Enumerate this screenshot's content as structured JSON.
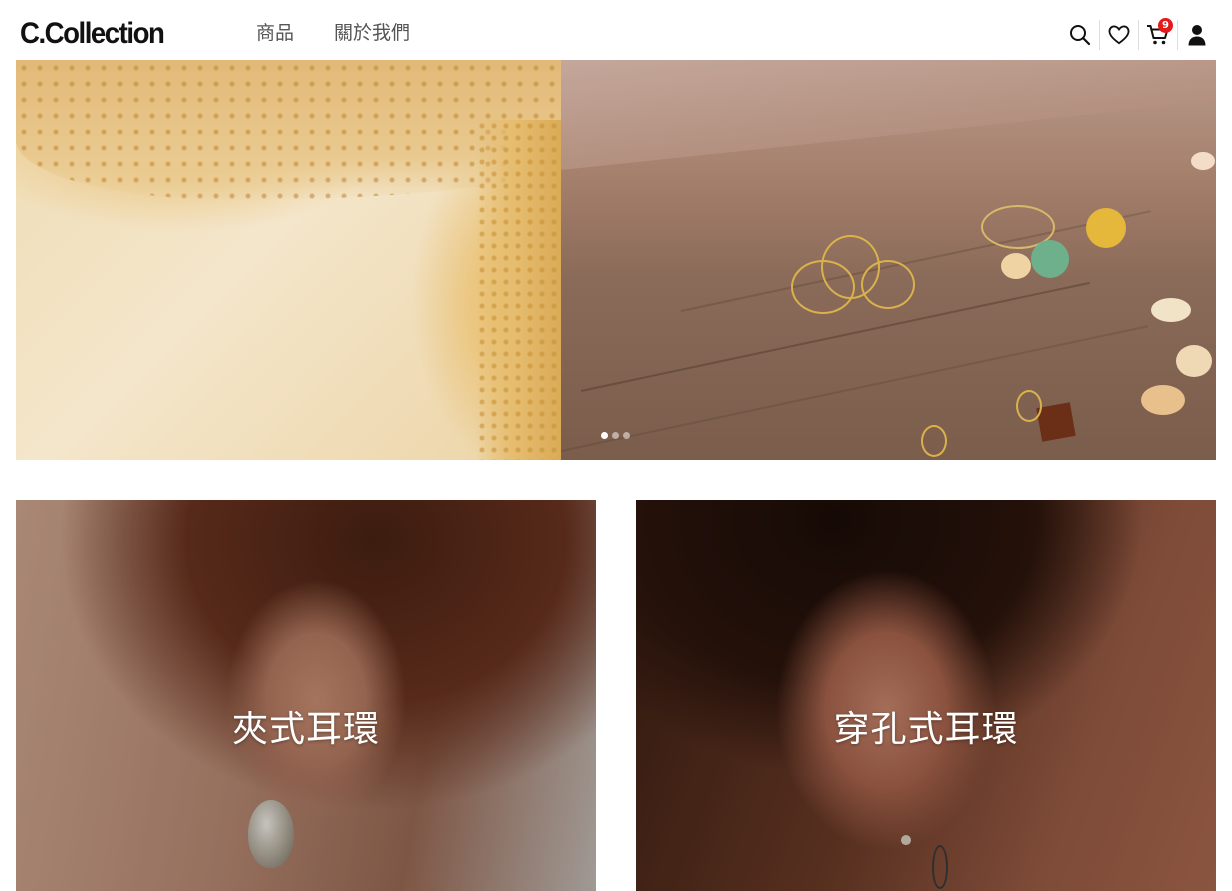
{
  "header": {
    "logo": "C.Collection",
    "nav": [
      {
        "label": "商品"
      },
      {
        "label": "關於我們"
      }
    ],
    "icons": [
      {
        "name": "search-icon"
      },
      {
        "name": "heart-icon"
      },
      {
        "name": "cart-icon",
        "badge": "9"
      },
      {
        "name": "user-icon"
      }
    ]
  },
  "hero": {
    "slides": [
      {
        "name": "lace-slide"
      },
      {
        "name": "earrings-slide"
      }
    ],
    "dots": 3,
    "active_dot": 1
  },
  "categories": [
    {
      "title": "夾式耳環"
    },
    {
      "title": "穿孔式耳環"
    }
  ],
  "colors": {
    "badge": "#e41a1a",
    "text": "#222222",
    "nav": "#555555"
  }
}
